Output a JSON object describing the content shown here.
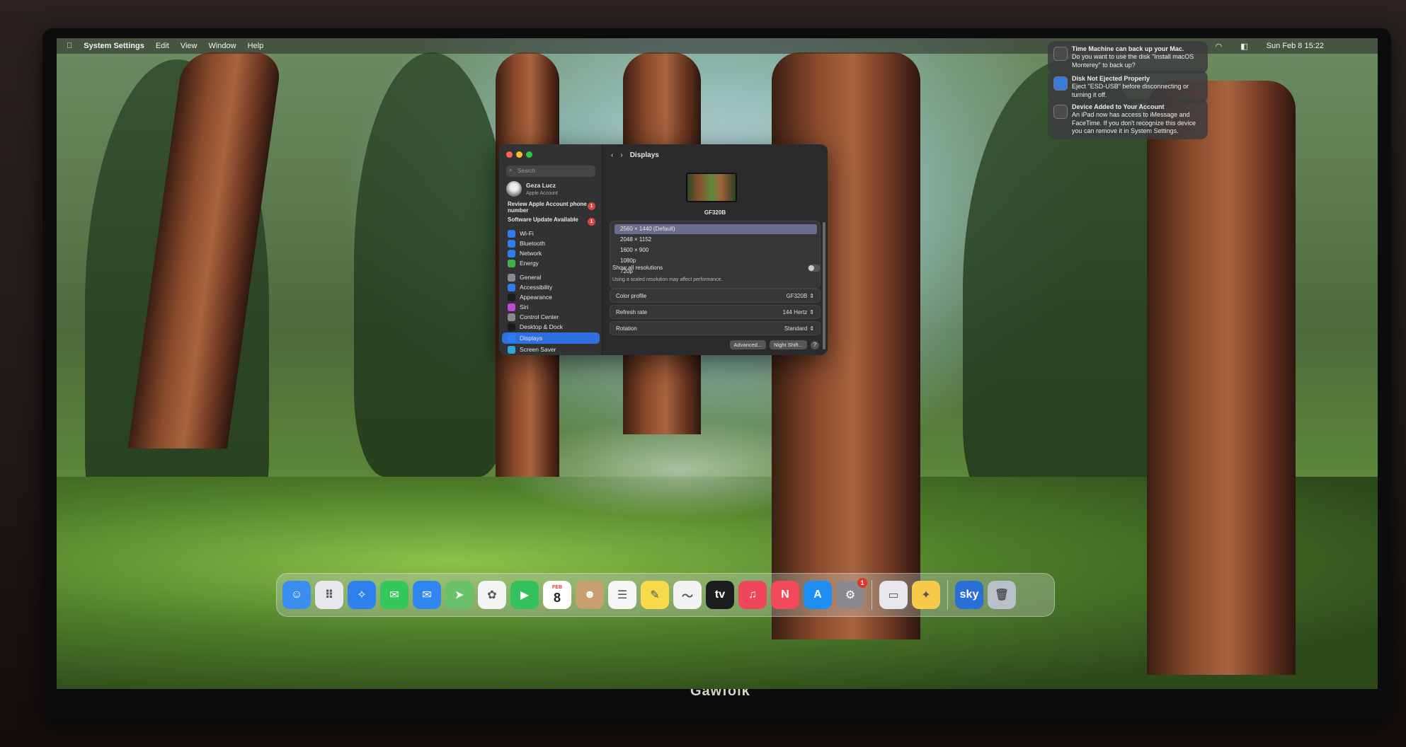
{
  "menubar": {
    "app": "System Settings",
    "items": [
      "Edit",
      "View",
      "Window",
      "Help"
    ],
    "clock": "Sun Feb 8  15:22"
  },
  "notifications": [
    {
      "title": "Time Machine can back up your Mac.",
      "body": "Do you want to use the disk \"Install macOS Monterey\" to back up?"
    },
    {
      "title": "Disk Not Ejected Properly",
      "body": "Eject \"ESD-USB\" before disconnecting or turning it off."
    },
    {
      "title": "Device Added to Your Account",
      "body": "An iPad now has access to iMessage and FaceTime. If you don't recognize this device you can remove it in System Settings."
    }
  ],
  "sidebar": {
    "search_placeholder": "Search",
    "account": {
      "name": "Geza Lucz",
      "sub": "Apple Account"
    },
    "alerts": [
      {
        "label": "Review Apple Account phone number",
        "badge": "1"
      },
      {
        "label": "Software Update Available",
        "badge": "1"
      }
    ],
    "items": [
      {
        "label": "Wi-Fi",
        "color": "#2f7ef0"
      },
      {
        "label": "Bluetooth",
        "color": "#2f7ef0"
      },
      {
        "label": "Network",
        "color": "#2f7ef0"
      },
      {
        "label": "Energy",
        "color": "#3cb44b"
      },
      {
        "label": "General",
        "color": "#8a8a8e"
      },
      {
        "label": "Accessibility",
        "color": "#2f7ef0"
      },
      {
        "label": "Appearance",
        "color": "#1c1c1e"
      },
      {
        "label": "Siri",
        "color": "#c04ad8"
      },
      {
        "label": "Control Center",
        "color": "#8a8a8e"
      },
      {
        "label": "Desktop & Dock",
        "color": "#1c1c1e"
      },
      {
        "label": "Displays",
        "color": "#2f7ef0"
      },
      {
        "label": "Screen Saver",
        "color": "#31a6d9"
      }
    ]
  },
  "displays": {
    "title": "Displays",
    "monitor_name": "GF320B",
    "resolutions": [
      "2560 × 1440 (Default)",
      "2048 × 1152",
      "1600 × 900",
      "1080p",
      "720p"
    ],
    "show_all_label": "Show all resolutions",
    "note": "Using a scaled resolution may affect performance.",
    "color_profile": {
      "label": "Color profile",
      "value": "GF320B"
    },
    "refresh_rate": {
      "label": "Refresh rate",
      "value": "144 Hertz"
    },
    "rotation": {
      "label": "Rotation",
      "value": "Standard"
    },
    "advanced_label": "Advanced...",
    "night_shift_label": "Night Shift...",
    "help_label": "?"
  },
  "dock": {
    "apps": [
      {
        "name": "finder-icon",
        "color": "#3a8ef0",
        "glyph": "☺"
      },
      {
        "name": "launchpad-icon",
        "color": "#e8e8ec",
        "glyph": "⠿"
      },
      {
        "name": "safari-icon",
        "color": "#2f80ed",
        "glyph": "✧"
      },
      {
        "name": "messages-icon",
        "color": "#34c759",
        "glyph": "✉"
      },
      {
        "name": "mail-icon",
        "color": "#2f86f0",
        "glyph": "✉"
      },
      {
        "name": "maps-icon",
        "color": "#6bc16a",
        "glyph": "➤"
      },
      {
        "name": "photos-icon",
        "color": "#f4f4f4",
        "glyph": "✿"
      },
      {
        "name": "facetime-icon",
        "color": "#32c15a",
        "glyph": "▶"
      },
      {
        "name": "calendar-icon",
        "color": "#ffffff",
        "glyph": ""
      },
      {
        "name": "contacts-icon",
        "color": "#c8a070",
        "glyph": "☻"
      },
      {
        "name": "reminders-icon",
        "color": "#f6f6f6",
        "glyph": "☰"
      },
      {
        "name": "notes-icon",
        "color": "#f7d94c",
        "glyph": "✎"
      },
      {
        "name": "freeform-icon",
        "color": "#f2f2f2",
        "glyph": "〜"
      },
      {
        "name": "apple-tv-icon",
        "color": "#1c1c1e",
        "glyph": "tv"
      },
      {
        "name": "music-icon",
        "color": "#f0455a",
        "glyph": "♫"
      },
      {
        "name": "news-icon",
        "color": "#f24a5c",
        "glyph": "N"
      },
      {
        "name": "app-store-icon",
        "color": "#1e8ef2",
        "glyph": "A"
      },
      {
        "name": "system-settings-icon",
        "color": "#8a8a8e",
        "glyph": "⚙"
      }
    ],
    "calendar": {
      "month": "FEB",
      "day": "8"
    },
    "settings_badge": "1",
    "extras": [
      {
        "name": "preview-icon",
        "color": "#e8e8ec",
        "glyph": "▭"
      },
      {
        "name": "tips-icon",
        "color": "#f7c948",
        "glyph": "✦"
      }
    ],
    "tail": [
      {
        "name": "sky-go-icon",
        "color": "#2a6ed6",
        "glyph": "sky"
      },
      {
        "name": "trash-icon",
        "color": "#b8c0c8",
        "glyph": "🗑"
      }
    ]
  },
  "brand": "Gawfolk"
}
